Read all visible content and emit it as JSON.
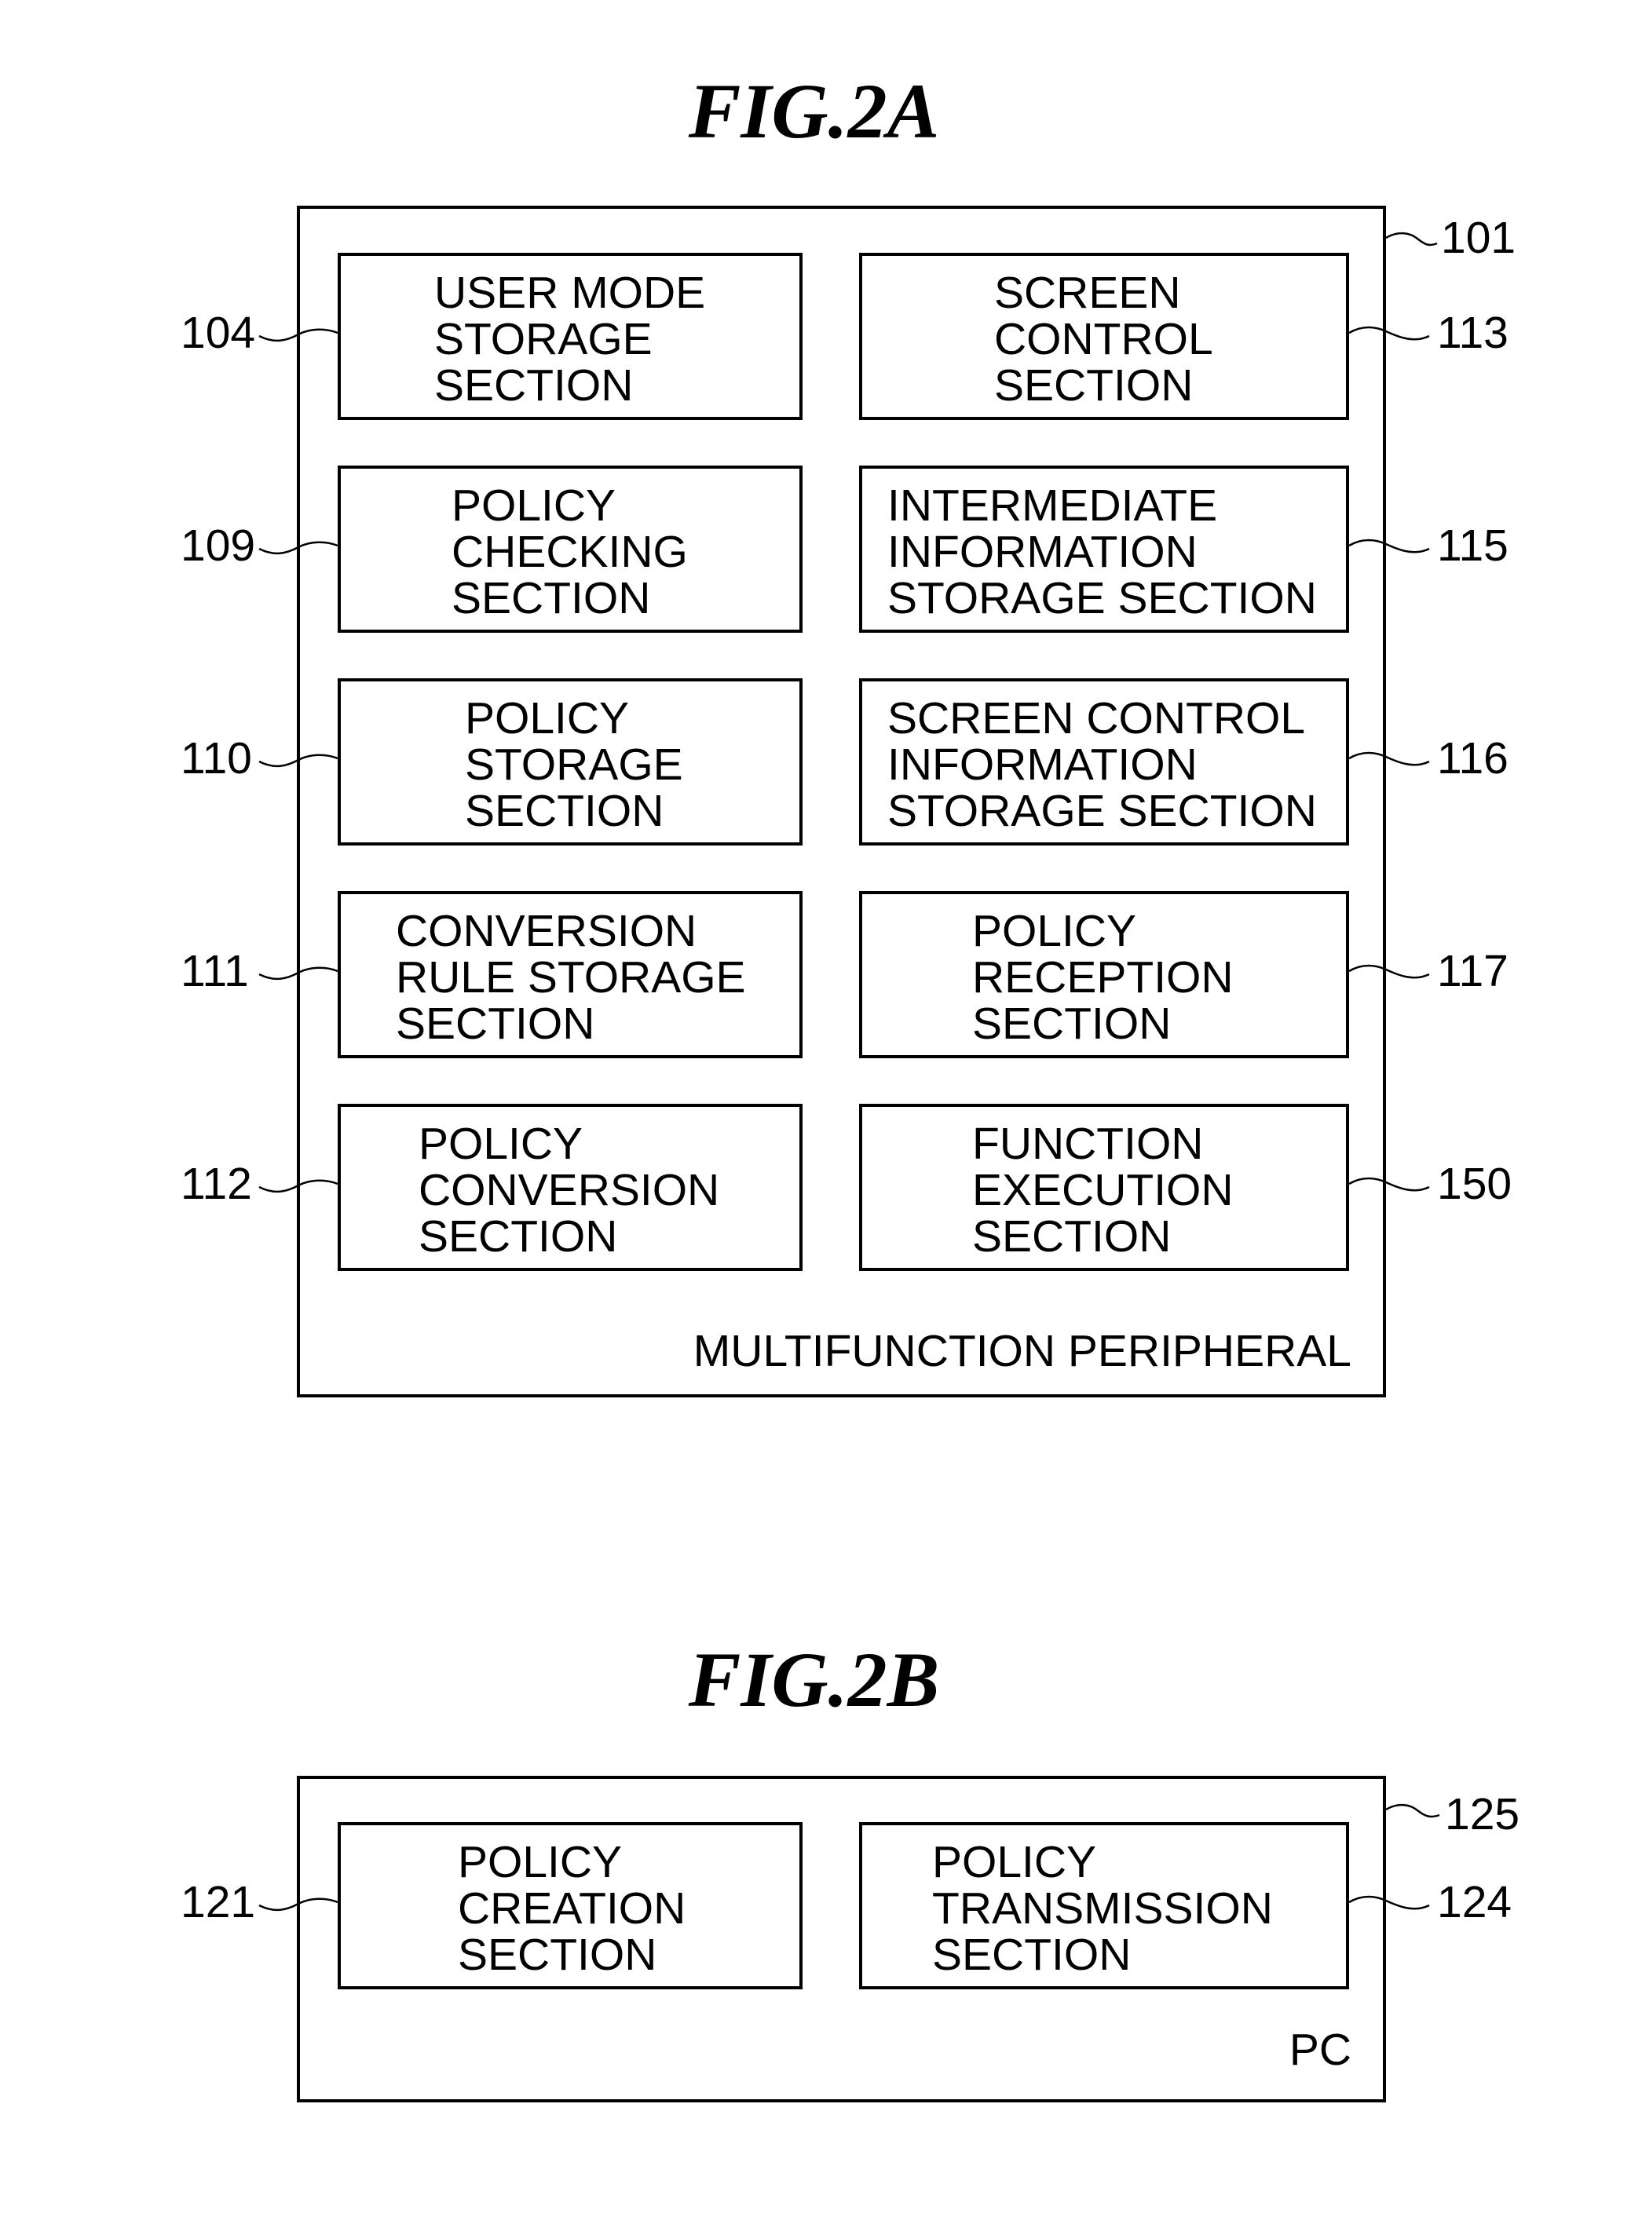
{
  "figures": [
    {
      "title": "FIG.2A",
      "device": {
        "label": "MULTIFUNCTION PERIPHERAL",
        "ref": "101"
      },
      "blocks": [
        {
          "ref": "104",
          "side": "left",
          "lines": [
            "USER MODE",
            "STORAGE",
            "SECTION"
          ]
        },
        {
          "ref": "113",
          "side": "right",
          "lines": [
            "SCREEN",
            "CONTROL",
            "SECTION"
          ]
        },
        {
          "ref": "109",
          "side": "left",
          "lines": [
            "POLICY",
            "CHECKING",
            "SECTION"
          ]
        },
        {
          "ref": "115",
          "side": "right",
          "lines": [
            "INTERMEDIATE",
            "INFORMATION",
            "STORAGE SECTION"
          ]
        },
        {
          "ref": "110",
          "side": "left",
          "lines": [
            "POLICY",
            "STORAGE",
            "SECTION"
          ]
        },
        {
          "ref": "116",
          "side": "right",
          "lines": [
            "SCREEN CONTROL",
            "INFORMATION",
            "STORAGE SECTION"
          ]
        },
        {
          "ref": "111",
          "side": "left",
          "lines": [
            "CONVERSION",
            "RULE STORAGE",
            "SECTION"
          ]
        },
        {
          "ref": "117",
          "side": "right",
          "lines": [
            "POLICY",
            "RECEPTION",
            "SECTION"
          ]
        },
        {
          "ref": "112",
          "side": "left",
          "lines": [
            "POLICY",
            "CONVERSION",
            "SECTION"
          ]
        },
        {
          "ref": "150",
          "side": "right",
          "lines": [
            "FUNCTION",
            "EXECUTION",
            "SECTION"
          ]
        }
      ]
    },
    {
      "title": "FIG.2B",
      "device": {
        "label": "PC",
        "ref": "125"
      },
      "blocks": [
        {
          "ref": "121",
          "side": "left",
          "lines": [
            "POLICY",
            "CREATION",
            "SECTION"
          ]
        },
        {
          "ref": "124",
          "side": "right",
          "lines": [
            "POLICY",
            "TRANSMISSION",
            "SECTION"
          ]
        }
      ]
    }
  ]
}
